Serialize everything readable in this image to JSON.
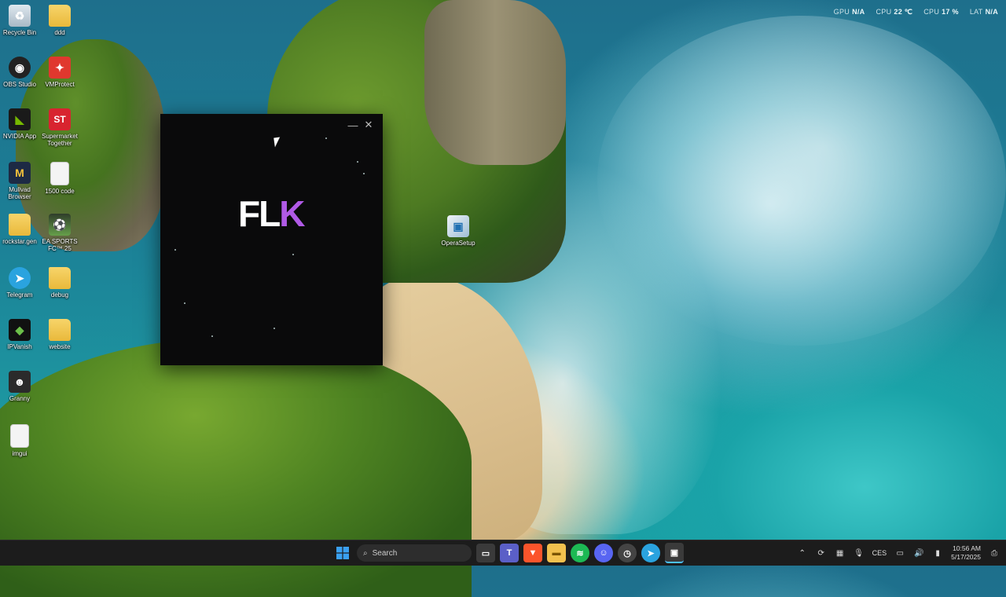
{
  "overlay": {
    "gpu_label": "GPU",
    "gpu_value": "N/A",
    "cpu_temp_label": "CPU",
    "cpu_temp_value": "22 ℃",
    "cpu_label": "CPU",
    "cpu_value": "17 %",
    "lat_label": "LAT",
    "lat_value": "N/A"
  },
  "desktop": {
    "icons": [
      {
        "label": "Recycle Bin",
        "icon": "recycle-bin-icon"
      },
      {
        "label": "ddd",
        "icon": "folder-icon"
      },
      {
        "label": "OBS Studio",
        "icon": "obs-icon"
      },
      {
        "label": "VMProtect",
        "icon": "vmprotect-icon"
      },
      {
        "label": "NVIDIA App",
        "icon": "nvidia-icon"
      },
      {
        "label": "Supermarket Together",
        "icon": "supermarket-together-icon",
        "glyph": "ST"
      },
      {
        "label": "Mullvad Browser",
        "icon": "mullvad-icon",
        "glyph": "M"
      },
      {
        "label": "1500 code",
        "icon": "text-file-icon"
      },
      {
        "label": "rockstar.gen",
        "icon": "folder-icon"
      },
      {
        "label": "EA SPORTS FC™ 25",
        "icon": "ea-fc-icon"
      },
      {
        "label": "Telegram",
        "icon": "telegram-icon"
      },
      {
        "label": "debug",
        "icon": "folder-icon"
      },
      {
        "label": "IPVanish",
        "icon": "ipvanish-icon"
      },
      {
        "label": "website",
        "icon": "folder-icon"
      },
      {
        "label": "Granny",
        "icon": "granny-icon"
      },
      {
        "label": "imgui",
        "icon": "file-icon"
      },
      {
        "label": "OperaSetup",
        "icon": "opera-setup-icon"
      }
    ]
  },
  "app_window": {
    "logo_main": "FL",
    "logo_accent": "K",
    "minimize_glyph": "—",
    "close_glyph": "✕"
  },
  "taskbar": {
    "search_placeholder": "Search",
    "apps": [
      "start",
      "search",
      "task-view",
      "teams",
      "brave",
      "file-explorer",
      "spotify",
      "discord",
      "clock-app",
      "telegram",
      "active-app"
    ],
    "tray": {
      "language": "CES",
      "time": "10:56 AM",
      "date": "5/17/2025"
    }
  }
}
